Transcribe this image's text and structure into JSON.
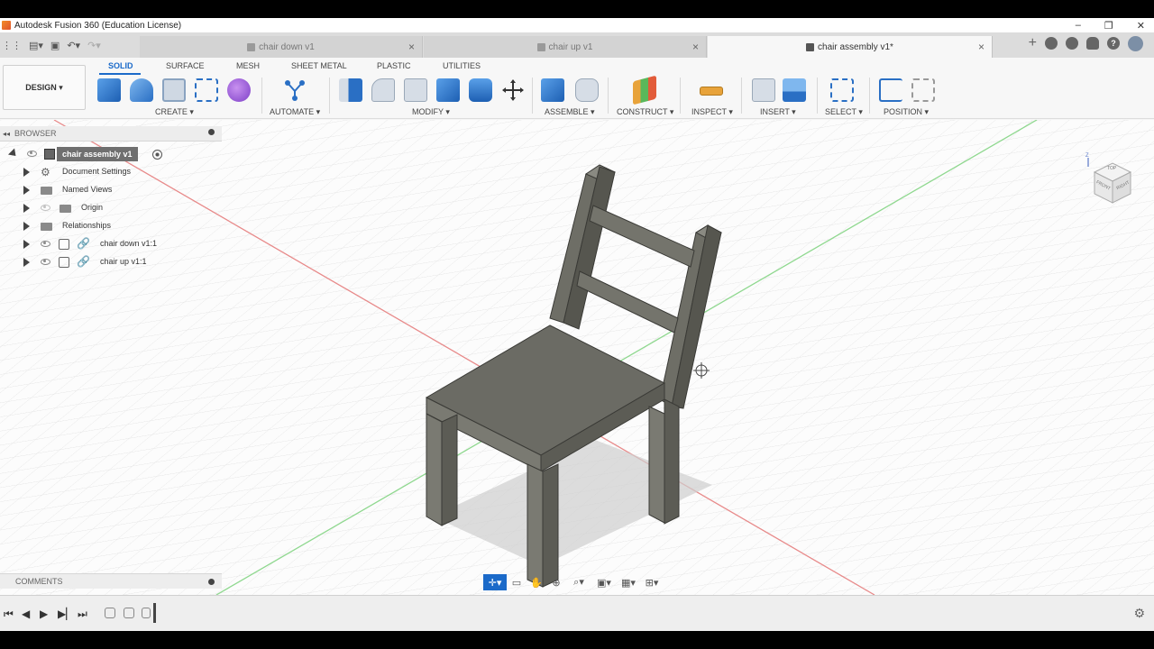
{
  "window": {
    "title": "Autodesk Fusion 360 (Education License)",
    "minimize": "–",
    "maximize": "❐",
    "close": "✕"
  },
  "tabs": [
    {
      "label": "chair down v1",
      "active": false
    },
    {
      "label": "chair up v1",
      "active": false
    },
    {
      "label": "chair assembly v1*",
      "active": true
    }
  ],
  "tab_close": "×",
  "tab_add": "+",
  "workspace": {
    "label": "DESIGN ▾"
  },
  "workspace_tabs": [
    "SOLID",
    "SURFACE",
    "MESH",
    "SHEET METAL",
    "PLASTIC",
    "UTILITIES"
  ],
  "tool_groups": [
    "CREATE ▾",
    "AUTOMATE ▾",
    "MODIFY ▾",
    "ASSEMBLE ▾",
    "CONSTRUCT ▾",
    "INSPECT ▾",
    "INSERT ▾",
    "SELECT ▾",
    "POSITION ▾"
  ],
  "browser": {
    "header": "BROWSER",
    "root": "chair assembly v1",
    "items": [
      "Document Settings",
      "Named Views",
      "Origin",
      "Relationships",
      "chair down v1:1",
      "chair up v1:1"
    ]
  },
  "comments": {
    "header": "COMMENTS"
  },
  "viewcube": {
    "top": "TOP",
    "front": "FRONT",
    "right": "RIGHT",
    "axis_z": "Z"
  },
  "colors": {
    "accent": "#1b6ac9",
    "chair": "#6b6b64",
    "x_axis": "#e88a8a",
    "y_axis": "#8fd88f"
  }
}
